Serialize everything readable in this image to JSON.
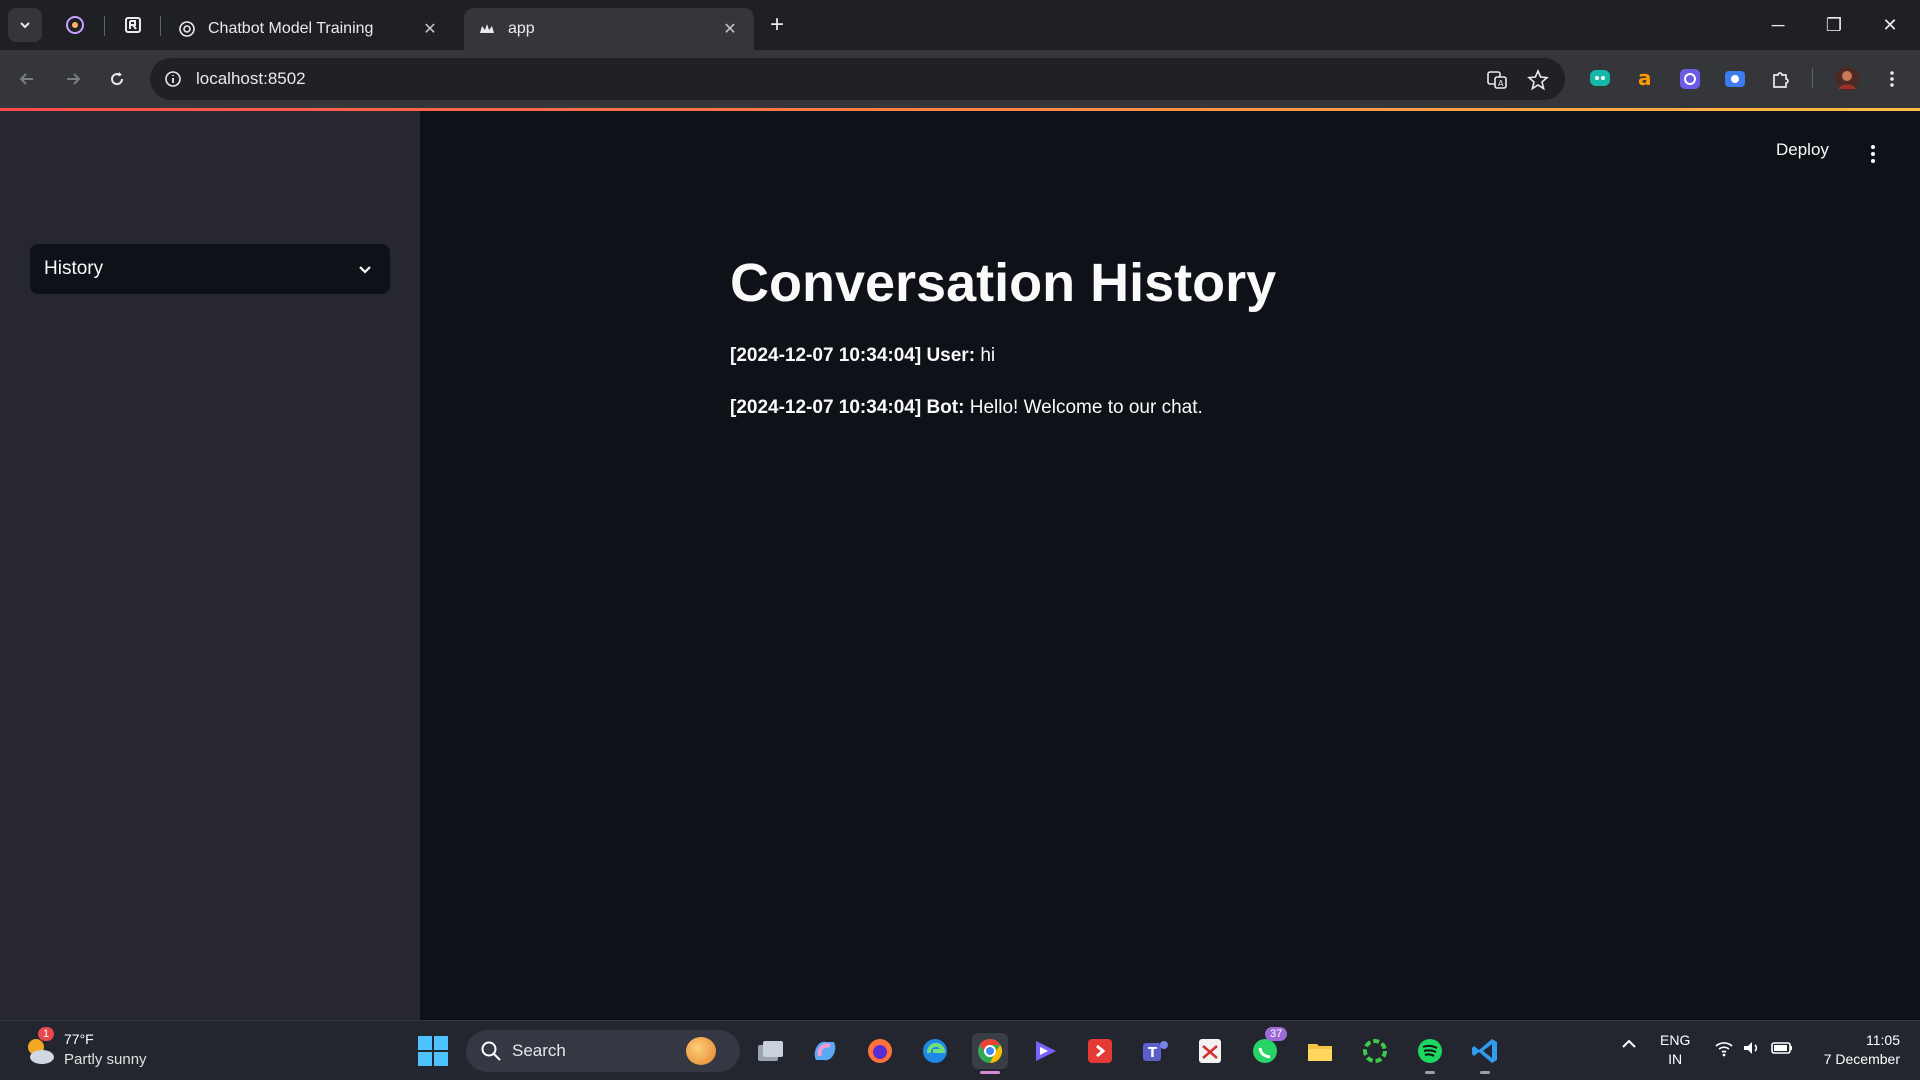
{
  "browser": {
    "tabs": [
      {
        "title": "Chatbot Model Training",
        "active": false
      },
      {
        "title": "app",
        "active": true
      }
    ],
    "address": "localhost:8502",
    "icons": {
      "tab_search": "chevron-down-icon",
      "new_tab": "+",
      "minimize": "─",
      "maximize": "❐",
      "close": "✕"
    }
  },
  "sidebar": {
    "select_value": "History"
  },
  "header": {
    "deploy_label": "Deploy"
  },
  "main": {
    "title": "Conversation History",
    "messages": [
      {
        "meta": "[2024-12-07 10:34:04] User:",
        "text": " hi"
      },
      {
        "meta": "[2024-12-07 10:34:04] Bot:",
        "text": " Hello! Welcome to our chat."
      }
    ]
  },
  "taskbar": {
    "weather_temp": "77°F",
    "weather_desc": "Partly sunny",
    "weather_badge": "1",
    "search_label": "Search",
    "whatsapp_badge": "37",
    "language_top": "ENG",
    "language_bottom": "IN",
    "time": "11:05",
    "date": "7 December"
  },
  "colors": {
    "accent": "#ff4b4b",
    "sidebar_bg": "#262730",
    "main_bg": "#0e1117"
  }
}
